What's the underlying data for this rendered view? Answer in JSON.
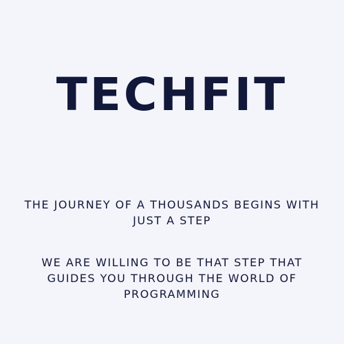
{
  "brand": {
    "title": "TECHFIT"
  },
  "taglines": [
    {
      "lines": [
        "THE JOURNEY OF A THOUSANDS BEGINS WITH",
        "JUST A STEP"
      ]
    },
    {
      "lines": [
        "WE ARE WILLING TO BE THAT STEP THAT",
        "GUIDES YOU THROUGH THE WORLD OF",
        "PROGRAMMING"
      ]
    }
  ],
  "colors": {
    "background": "#f4f5fb",
    "text": "#12183a"
  }
}
